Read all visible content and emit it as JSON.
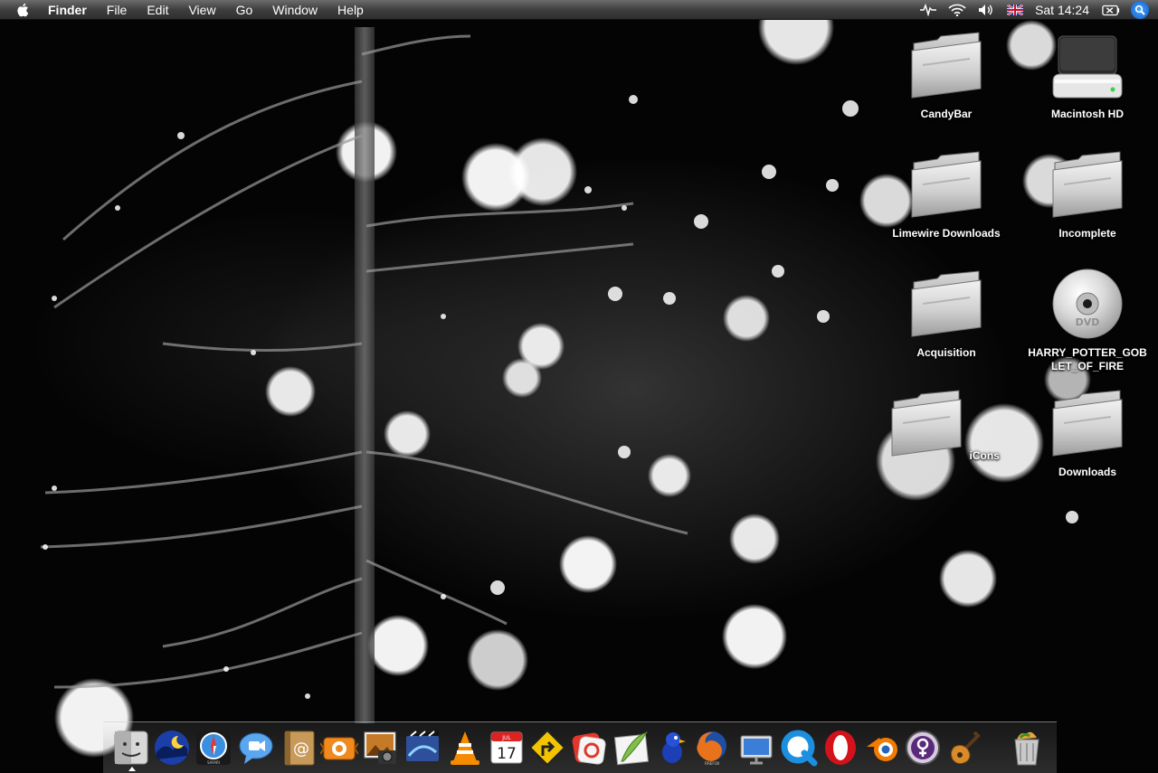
{
  "menubar": {
    "app_name": "Finder",
    "menus": [
      "File",
      "Edit",
      "View",
      "Go",
      "Window",
      "Help"
    ],
    "clock": "Sat 14:24",
    "status_icons": [
      "activity-icon",
      "wifi-icon",
      "volume-icon",
      "uk-flag-icon",
      "battery-icon",
      "spotlight-icon"
    ]
  },
  "desktop": {
    "icons": [
      {
        "label": "CandyBar",
        "icon": "folder-icon"
      },
      {
        "label": "Macintosh HD",
        "icon": "hard-drive-icon"
      },
      {
        "label": "Limewire Downloads",
        "icon": "folder-icon"
      },
      {
        "label": "Incomplete",
        "icon": "folder-icon"
      },
      {
        "label": "Acquisition",
        "icon": "folder-icon"
      },
      {
        "label": "HARRY_POTTER_GOBLET_OF_FIRE",
        "icon": "dvd-icon"
      },
      {
        "label": "iCons",
        "icon": "folder-icon"
      },
      {
        "label": "Downloads",
        "icon": "folder-icon"
      }
    ],
    "dvd_text": "DVD"
  },
  "dock": {
    "items": [
      {
        "name": "finder-icon"
      },
      {
        "name": "camino-icon"
      },
      {
        "name": "safari-icon",
        "caption": "SAFARI"
      },
      {
        "name": "ichat-icon"
      },
      {
        "name": "address-book-icon"
      },
      {
        "name": "candybar-icon"
      },
      {
        "name": "iphoto-icon"
      },
      {
        "name": "imovie-icon"
      },
      {
        "name": "vlc-icon"
      },
      {
        "name": "ical-icon",
        "month": "JUL",
        "day": "17"
      },
      {
        "name": "transmit-icon"
      },
      {
        "name": "growl-icon"
      },
      {
        "name": "preview-icon"
      },
      {
        "name": "adium-icon"
      },
      {
        "name": "firefox-icon",
        "caption": "FIREFOX"
      },
      {
        "name": "network-icon"
      },
      {
        "name": "quicktime-icon"
      },
      {
        "name": "opera-icon"
      },
      {
        "name": "blender-icon"
      },
      {
        "name": "adium-duck-icon"
      },
      {
        "name": "garageband-icon"
      },
      {
        "name": "trash-icon"
      }
    ]
  }
}
